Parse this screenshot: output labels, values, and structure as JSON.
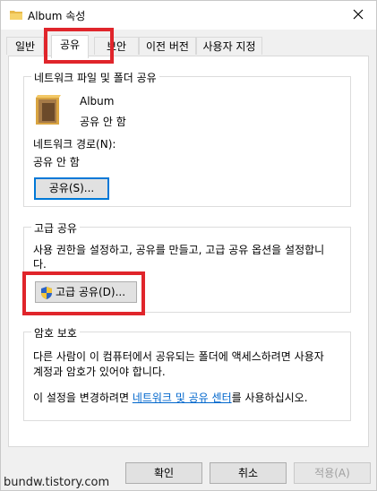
{
  "window": {
    "title": "Album 속성"
  },
  "tabs": [
    {
      "label": "일반"
    },
    {
      "label": "공유"
    },
    {
      "label": "보안"
    },
    {
      "label": "이전 버전"
    },
    {
      "label": "사용자 지정"
    }
  ],
  "network_share": {
    "legend": "네트워크 파일 및 폴더 공유",
    "folder_name": "Album",
    "folder_status": "공유 안 함",
    "path_label": "네트워크 경로(N):",
    "path_value": "공유 안 함",
    "share_button": "공유(S)..."
  },
  "advanced_share": {
    "legend": "고급 공유",
    "description_line1": "사용 권한을 설정하고, 공유를 만들고, 고급 공유 옵션을 설정합니",
    "description_line2": "다.",
    "button": "고급 공유(D)..."
  },
  "password_protect": {
    "legend": "암호 보호",
    "description_line1": "다른 사람이 이 컴퓨터에서 공유되는 폴더에 액세스하려면 사용자",
    "description_line2": "계정과 암호가 있어야 합니다.",
    "change_prefix": "이 설정을 변경하려면 ",
    "change_link": "네트워크 및 공유 센터",
    "change_suffix": "를 사용하십시오."
  },
  "footer": {
    "ok": "확인",
    "cancel": "취소",
    "apply": "적용(A)"
  },
  "watermark": "bundw.tistory.com",
  "colors": {
    "highlight": "#e0252b",
    "link": "#0066cc",
    "focus": "#0078d7"
  }
}
